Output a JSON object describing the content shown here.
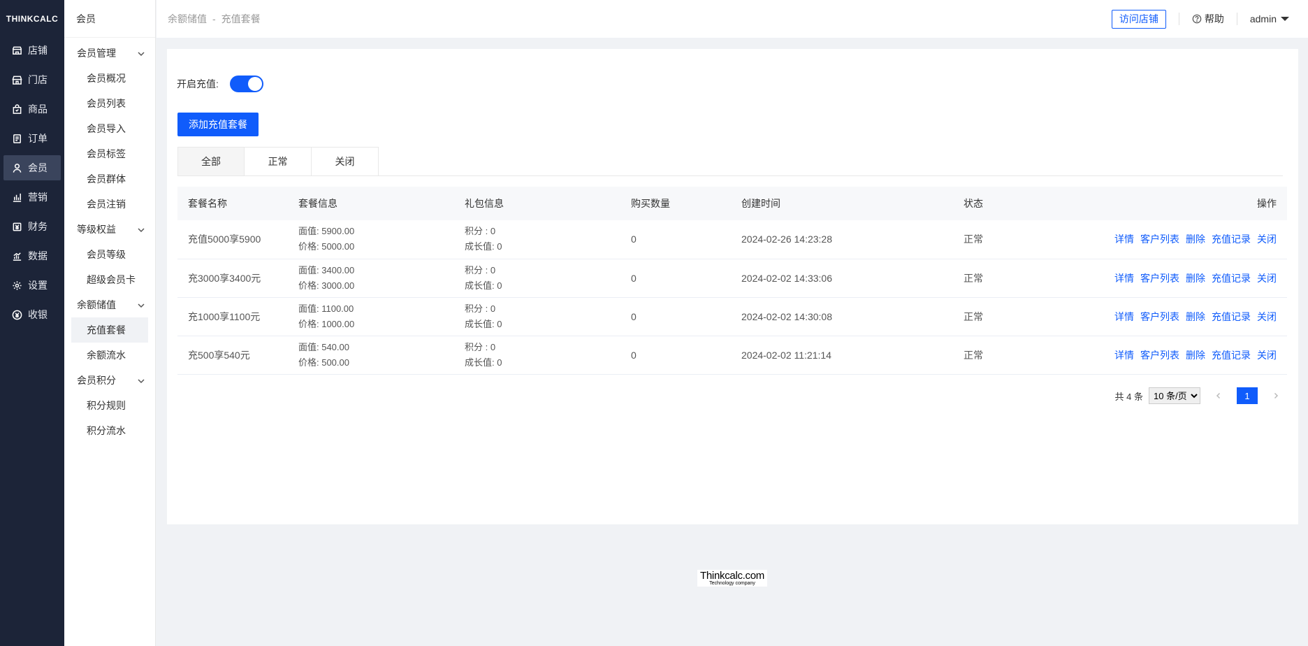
{
  "brand": "THINKCALC",
  "nav": [
    {
      "label": "店铺",
      "icon": "store-icon"
    },
    {
      "label": "门店",
      "icon": "shop-icon"
    },
    {
      "label": "商品",
      "icon": "goods-icon"
    },
    {
      "label": "订单",
      "icon": "order-icon"
    },
    {
      "label": "会员",
      "icon": "user-icon",
      "active": true
    },
    {
      "label": "营销",
      "icon": "chart-bar-icon"
    },
    {
      "label": "财务",
      "icon": "finance-icon"
    },
    {
      "label": "数据",
      "icon": "data-icon"
    },
    {
      "label": "设置",
      "icon": "gear-icon"
    },
    {
      "label": "收银",
      "icon": "cashier-icon"
    }
  ],
  "subnav": {
    "title": "会员",
    "groups": [
      {
        "label": "会员管理",
        "items": [
          "会员概况",
          "会员列表",
          "会员导入",
          "会员标签",
          "会员群体",
          "会员注销"
        ]
      },
      {
        "label": "等级权益",
        "items": [
          "会员等级",
          "超级会员卡"
        ]
      },
      {
        "label": "余额储值",
        "items": [
          "充值套餐",
          "余额流水"
        ]
      },
      {
        "label": "会员积分",
        "items": [
          "积分规则",
          "积分流水"
        ]
      }
    ],
    "active_item": "充值套餐"
  },
  "header": {
    "breadcrumb": [
      "余额储值",
      "充值套餐"
    ],
    "breadcrumb_sep": "-",
    "visit_label": "访问店铺",
    "help_label": "帮助",
    "user_label": "admin"
  },
  "main": {
    "toggle_label": "开启充值:",
    "toggle_on": true,
    "add_button": "添加充值套餐",
    "tabs": [
      "全部",
      "正常",
      "关闭"
    ],
    "columns": [
      "套餐名称",
      "套餐信息",
      "礼包信息",
      "购买数量",
      "创建时间",
      "状态",
      "操作"
    ],
    "rows": [
      {
        "name": "充值5000享5900",
        "face": "面值: 5900.00",
        "price": "价格: 5000.00",
        "points": "积分 : 0",
        "growth": "成长值: 0",
        "qty": "0",
        "created": "2024-02-26 14:23:28",
        "status": "正常"
      },
      {
        "name": "充3000享3400元",
        "face": "面值: 3400.00",
        "price": "价格: 3000.00",
        "points": "积分 : 0",
        "growth": "成长值: 0",
        "qty": "0",
        "created": "2024-02-02 14:33:06",
        "status": "正常"
      },
      {
        "name": "充1000享1100元",
        "face": "面值: 1100.00",
        "price": "价格: 1000.00",
        "points": "积分 : 0",
        "growth": "成长值: 0",
        "qty": "0",
        "created": "2024-02-02 14:30:08",
        "status": "正常"
      },
      {
        "name": "充500享540元",
        "face": "面值: 540.00",
        "price": "价格: 500.00",
        "points": "积分 : 0",
        "growth": "成长值: 0",
        "qty": "0",
        "created": "2024-02-02 11:21:14",
        "status": "正常"
      }
    ],
    "actions": [
      "详情",
      "客户列表",
      "删除",
      "充值记录",
      "关闭"
    ],
    "pager": {
      "total_text": "共 4 条",
      "page_size": "10 条/页",
      "current_page": "1"
    }
  },
  "footer": {
    "logo_main": "Thinkcalc.com",
    "logo_sub": "Technology company"
  },
  "colors": {
    "primary": "#105cfb",
    "nav_bg": "#1c2438",
    "nav_active": "#3a445c"
  }
}
